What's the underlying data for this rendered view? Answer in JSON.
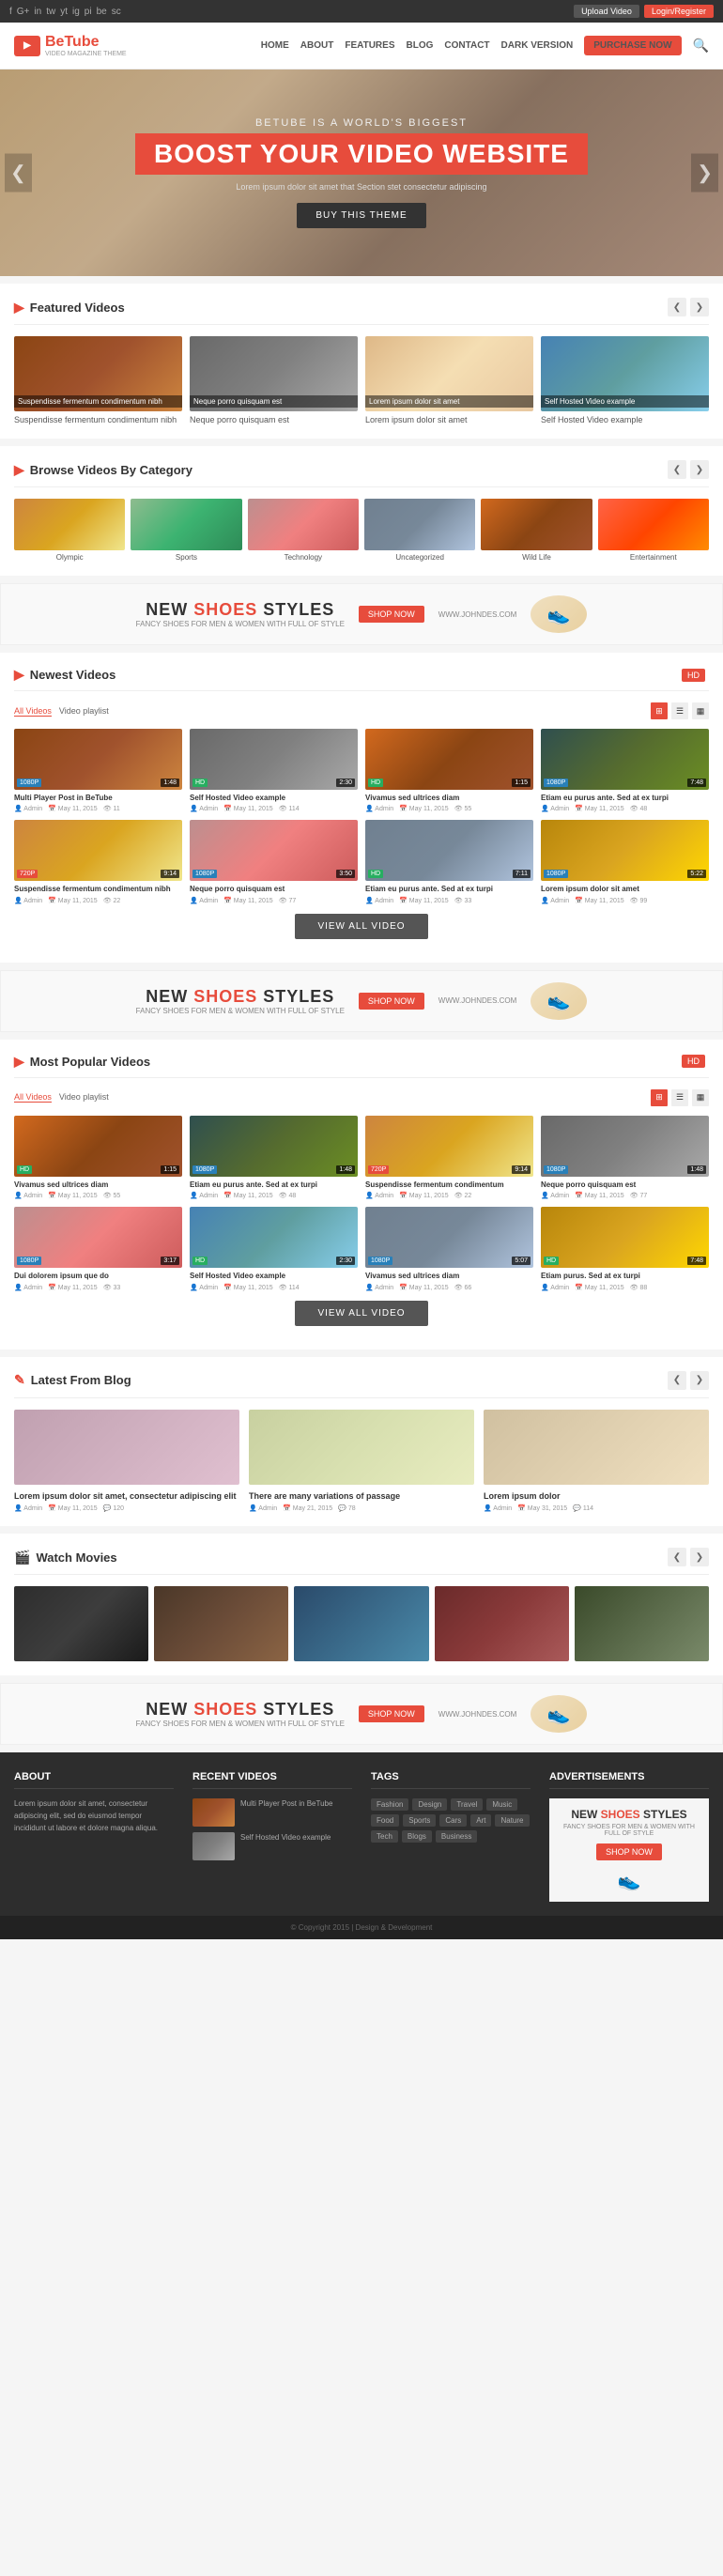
{
  "topbar": {
    "social_icons": [
      "f",
      "g+",
      "in",
      "tw",
      "yt",
      "ig",
      "pi",
      "be",
      "sc"
    ],
    "upload_btn": "Upload Video",
    "login_btn": "Login/Register"
  },
  "nav": {
    "logo_icon": "▶",
    "logo_text": "BeTube",
    "logo_sub": "VIDEO MAGAZINE THEME",
    "links": [
      "HOME",
      "ABOUT",
      "FEATURES",
      "BLOG",
      "CONTACT",
      "DARK VERSION",
      "PURCHASE NOW"
    ],
    "search_icon": "🔍"
  },
  "hero": {
    "sub_title": "BETUBE IS A WORLD'S BIGGEST",
    "main_title": "BOOST YOUR VIDEO WEBSITE",
    "description": "Lorem ipsum dolor sit amet that Section stet consectetur adipiscing",
    "cta_btn": "BUY THIS THEME",
    "arrow_left": "❮",
    "arrow_right": "❯"
  },
  "featured": {
    "title": "Featured Videos",
    "prev": "❮",
    "next": "❯",
    "videos": [
      {
        "label": "Suspendisse fermentum condimentum nibh",
        "color": "thumb-c1"
      },
      {
        "label": "Neque porro quisquam est",
        "color": "thumb-c2"
      },
      {
        "label": "Lorem ipsum dolor sit amet",
        "color": "thumb-c3"
      },
      {
        "label": "Self Hosted Video example",
        "color": "thumb-c4"
      }
    ]
  },
  "categories": {
    "title": "Browse Videos By Category",
    "prev": "❮",
    "next": "❯",
    "items": [
      {
        "label": "Olympic",
        "color": "thumb-c5"
      },
      {
        "label": "Sports",
        "color": "thumb-c6"
      },
      {
        "label": "Technology",
        "color": "thumb-c7"
      },
      {
        "label": "Uncategorized",
        "color": "thumb-c8"
      },
      {
        "label": "Wild Life",
        "color": "thumb-c9"
      },
      {
        "label": "Entertainment",
        "color": "thumb-c10"
      }
    ]
  },
  "ad_banner_1": {
    "line1": "NEW",
    "highlight": "SHOES",
    "line2": "STYLES",
    "sub": "FANCY SHOES FOR MEN & WOMEN WITH FULL OF STYLE",
    "shop_btn": "SHOP NOW",
    "website": "WWW.JOHNDES.COM"
  },
  "newest_videos": {
    "title": "Newest Videos",
    "hd_toggle": "HD",
    "filter_all": "All Videos",
    "filter_videos": "Video playlist",
    "view_all_btn": "VIEW ALL VIDEO",
    "cards": [
      {
        "title": "Multi Player Post in BeTube",
        "badge": "1080P",
        "badge_type": "p1080",
        "duration": "1:48",
        "color": "thumb-c1",
        "author": "Admin",
        "date": "May 11, 2015",
        "views": "11"
      },
      {
        "title": "Self Hosted Video example",
        "badge": "HD",
        "badge_type": "hd",
        "duration": "2:30",
        "color": "thumb-c2",
        "author": "Admin",
        "date": "May 11, 2015",
        "views": "114"
      },
      {
        "title": "Vivamus sed ultrices diam",
        "badge": "HD",
        "badge_type": "hd",
        "duration": "1:15",
        "color": "thumb-c9",
        "author": "Admin",
        "date": "May 11, 2015",
        "views": "55"
      },
      {
        "title": "Etiam eu purus ante. Sed at ex turpi",
        "badge": "1080P",
        "badge_type": "p1080",
        "duration": "7:48",
        "color": "thumb-c11",
        "author": "Admin",
        "date": "May 11, 2015",
        "views": "48"
      },
      {
        "title": "Suspendisse fermentum condimentum nibh",
        "badge": "720P",
        "badge_type": "p720",
        "duration": "9:14",
        "color": "thumb-c5",
        "author": "Admin",
        "date": "May 11, 2015",
        "views": "22"
      },
      {
        "title": "Neque porro quisquam est",
        "badge": "1080P",
        "badge_type": "p1080",
        "duration": "3:50",
        "color": "thumb-c7",
        "author": "Admin",
        "date": "May 11, 2015",
        "views": "77"
      },
      {
        "title": "Etiam eu purus ante. Sed at ex turpi",
        "badge": "HD",
        "badge_type": "hd",
        "duration": "7:11",
        "color": "thumb-c8",
        "author": "Admin",
        "date": "May 11, 2015",
        "views": "33"
      },
      {
        "title": "Lorem ipsum dolor sit amet",
        "badge": "1080P",
        "badge_type": "p1080",
        "duration": "5:22",
        "color": "thumb-c12",
        "author": "Admin",
        "date": "May 11, 2015",
        "views": "99"
      }
    ]
  },
  "ad_banner_2": {
    "line1": "NEW",
    "highlight": "SHOES",
    "line2": "STYLES",
    "sub": "FANCY SHOES FOR MEN & WOMEN WITH FULL OF STYLE",
    "shop_btn": "SHOP NOW",
    "website": "WWW.JOHNDES.COM"
  },
  "popular_videos": {
    "title": "Most Popular Videos",
    "hd_toggle": "HD",
    "filter_all": "All Videos",
    "filter_videos": "Video playlist",
    "view_all_btn": "VIEW ALL VIDEO",
    "cards": [
      {
        "title": "Vivamus sed ultrices diam",
        "badge": "HD",
        "badge_type": "hd",
        "duration": "1:15",
        "color": "thumb-c9",
        "author": "Admin",
        "date": "May 11, 2015",
        "views": "55"
      },
      {
        "title": "Etiam eu purus ante. Sed at ex turpi",
        "badge": "1080P",
        "badge_type": "p1080",
        "duration": "1:48",
        "color": "thumb-c11",
        "author": "Admin",
        "date": "May 11, 2015",
        "views": "48"
      },
      {
        "title": "Suspendisse fermentum condimentum",
        "badge": "720P",
        "badge_type": "p720",
        "duration": "9:14",
        "color": "thumb-c5",
        "author": "Admin",
        "date": "May 11, 2015",
        "views": "22"
      },
      {
        "title": "Neque porro quisquam est",
        "badge": "1080P",
        "badge_type": "p1080",
        "duration": "1:48",
        "color": "thumb-c2",
        "author": "Admin",
        "date": "May 11, 2015",
        "views": "77"
      },
      {
        "title": "Dui dolorem ipsum que do",
        "badge": "1080P",
        "badge_type": "p1080",
        "duration": "3:17",
        "color": "thumb-c7",
        "author": "Admin",
        "date": "May 11, 2015",
        "views": "33"
      },
      {
        "title": "Self Hosted Video example",
        "badge": "HD",
        "badge_type": "hd",
        "duration": "2:30",
        "color": "thumb-c4",
        "author": "Admin",
        "date": "May 11, 2015",
        "views": "114"
      },
      {
        "title": "Vivamus sed ultrices diam",
        "badge": "1080P",
        "badge_type": "p1080",
        "duration": "5:07",
        "color": "thumb-c8",
        "author": "Admin",
        "date": "May 11, 2015",
        "views": "66"
      },
      {
        "title": "Etiam purus. Sed at ex turpi",
        "badge": "HD",
        "badge_type": "hd",
        "duration": "7:48",
        "color": "thumb-c12",
        "author": "Admin",
        "date": "May 11, 2015",
        "views": "88"
      }
    ]
  },
  "blog": {
    "title": "Latest From Blog",
    "prev": "❮",
    "next": "❯",
    "posts": [
      {
        "title": "Lorem ipsum dolor sit amet, consectetur adipiscing elit",
        "author": "Admin",
        "date": "May 11, 2015",
        "comments": "120",
        "color": "blog-img1"
      },
      {
        "title": "There are many variations of passage",
        "author": "Admin",
        "date": "May 21, 2015",
        "comments": "78",
        "color": "blog-img2"
      },
      {
        "title": "Lorem ipsum dolor",
        "author": "Admin",
        "date": "May 31, 2015",
        "comments": "114",
        "color": "blog-img3"
      }
    ]
  },
  "movies": {
    "title": "Watch Movies",
    "prev": "❮",
    "next": "❯",
    "items": [
      {
        "color": "movie-c1"
      },
      {
        "color": "movie-c2"
      },
      {
        "color": "movie-c3"
      },
      {
        "color": "movie-c4"
      },
      {
        "color": "movie-c5"
      }
    ]
  },
  "ad_banner_3": {
    "line1": "NEW",
    "highlight": "SHOES",
    "line2": "STYLES",
    "sub": "FANCY SHOES FOR MEN & WOMEN WITH FULL OF STYLE",
    "shop_btn": "SHOP NOW",
    "website": "WWW.JOHNDES.COM"
  },
  "footer": {
    "about_title": "About",
    "about_text": "Lorem ipsum dolor sit amet, consectetur adipiscing elit, sed do eiusmod tempor incididunt ut labore et dolore magna aliqua.",
    "recent_title": "Recent Videos",
    "recent_videos": [
      {
        "title": "Multi Player Post in BeTube",
        "color": "thumb-c1"
      },
      {
        "title": "Self Hosted Video example",
        "color": "thumb-c2"
      }
    ],
    "tags_title": "Tags",
    "tags": [
      "Fashion",
      "Design",
      "Travel",
      "Music",
      "Food",
      "Sports",
      "Cars",
      "Art",
      "Nature",
      "Tech",
      "Blogs",
      "Business"
    ],
    "ads_title": "Advertisements",
    "bottom_text": "© Copyright 2015 | Design & Development"
  }
}
